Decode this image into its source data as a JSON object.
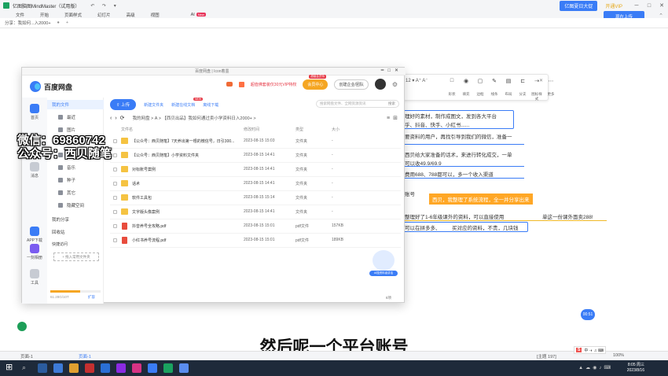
{
  "app": {
    "title": "亿图脑图MindMaster（试用版）",
    "quick_actions": "↶ ↷ ▾",
    "banner": "亿图夏日大促",
    "vip_label": "开通VIP",
    "upload_label": "现在上传",
    "menus": [
      "文件",
      "开始",
      "页面样式",
      "幻灯片",
      "高级",
      "视图",
      "AI"
    ],
    "ai_badge": "New",
    "doc_tab": "分享：我如何...入2000+",
    "canvas_toolbar": {
      "font_size_label": "12",
      "tool_labels": [
        "形状",
        "填充",
        "边框",
        "线条",
        "布局",
        "分支",
        "图标样式",
        "更多"
      ]
    }
  },
  "mindmap": {
    "nodes": [
      "理好的素材，制作成图文，发到各大平台",
      "乎、抖音、快手、小红书......",
      "要资料的用户，再找引导到我们的微信，准备一",
      "西贝给大家准备的话术，来进行转化成交，一单",
      "可以收49.9/69.9",
      "费用688、788都可以，多一个收入渠道",
      "账号",
      "西贝，我整理了系统流程，全一并分享出来",
      "整理好了1-6年级课外的资料，可以直接使用",
      "单这一份课外面卖288!",
      "可以在拼多多、",
      "买对应的资料，不贵，几块钱"
    ]
  },
  "baidu": {
    "window_tabs": "百度网盘  |  Icon着墨",
    "name": "百度网盘",
    "vip_promo": "超值佛套装仅30元VIP特权",
    "member_center": "会员中心",
    "member_tag": "超级会员特",
    "create_team": "创建企业/团队",
    "leftbar": [
      "首页",
      "消息",
      "APP下载",
      "一刻相册",
      "工具"
    ],
    "nav": {
      "my_files": "我的文件",
      "items": [
        "最近",
        "图片",
        "文档",
        "视频",
        "音乐",
        "种子",
        "其它",
        "隐藏空间"
      ],
      "my_share": "我的分享",
      "recycle": "回收站",
      "quick_access": "快捷访问",
      "add_quick": "+ 拖入常用文件夹",
      "quota": "61.28G/10T",
      "expand": "扩容"
    },
    "toolbar": {
      "upload": "上传",
      "new_folder": "新建文件夹",
      "new_online_doc": "新建在线文档",
      "new_badge": "NEW",
      "offline_download": "离线下载",
      "search_placeholder": "搜索网盘文件、全网资源资讯",
      "search_btn": "搜索"
    },
    "path": {
      "breadcrumb": "我的网盘  >  A  >  【西贝出品】我如何通过卖小学资料日入2000+  >"
    },
    "table": {
      "headers": [
        "文件名",
        "修改时间",
        "类型",
        "大小"
      ],
      "rows": [
        {
          "name": "【公众号：西贝随笔】7天养出第一根的微信号，日引300...",
          "time": "2023-08-15 15:03",
          "type": "文件夹",
          "size": "-",
          "kind": "folder"
        },
        {
          "name": "【公众号：西贝随笔】小学资料文件夹",
          "time": "2023-08-15 14:41",
          "type": "文件夹",
          "size": "-",
          "kind": "folder"
        },
        {
          "name": "对标账号案例",
          "time": "2023-08-15 14:41",
          "type": "文件夹",
          "size": "-",
          "kind": "folder"
        },
        {
          "name": "话术",
          "time": "2023-08-15 14:41",
          "type": "文件夹",
          "size": "-",
          "kind": "folder"
        },
        {
          "name": "软件工具包",
          "time": "2023-08-15 15:14",
          "type": "文件夹",
          "size": "-",
          "kind": "folder"
        },
        {
          "name": "文字版头像案例",
          "time": "2023-08-15 14:41",
          "type": "文件夹",
          "size": "-",
          "kind": "folder"
        },
        {
          "name": "抖音养号全攻略.pdf",
          "time": "2023-08-15 15:01",
          "type": "pdf文件",
          "size": "157KB",
          "kind": "pdf"
        },
        {
          "name": "小红书养号流程.pdf",
          "time": "2023-08-15 15:01",
          "type": "pdf文件",
          "size": "189KB",
          "kind": "pdf"
        }
      ]
    },
    "ai_label": "AI搜资料者讲话",
    "page_status": "8项"
  },
  "overlay": {
    "watermark_line1": "微信：69860742",
    "watermark_line2": "公众号：西贝随笔",
    "subtitle": "然后呢一个平台账号",
    "timer": "00:51"
  },
  "statusbar": {
    "page": "页面-1",
    "page_tab": "页面-1",
    "topic_count": "[主题 197]",
    "zoom": "100%"
  },
  "taskbar": {
    "time": "8:05 周三",
    "date": "2023/8/16"
  }
}
